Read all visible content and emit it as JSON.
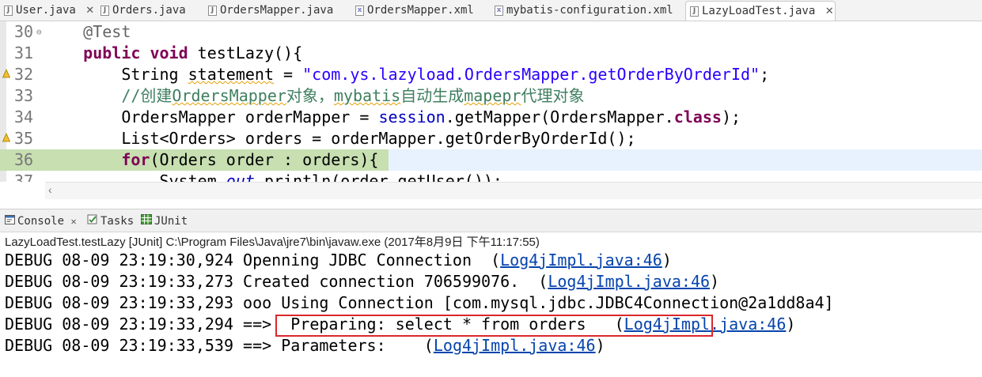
{
  "editor_tabs": [
    {
      "label": "User.java",
      "type": "java",
      "close": "✕"
    },
    {
      "label": "Orders.java",
      "type": "java"
    },
    {
      "label": "OrdersMapper.java",
      "type": "java"
    },
    {
      "label": "OrdersMapper.xml",
      "type": "xml"
    },
    {
      "label": "mybatis-configuration.xml",
      "type": "xml"
    },
    {
      "label": "LazyLoadTest.java",
      "type": "java",
      "active": true,
      "close": "✕"
    }
  ],
  "code_lines": [
    {
      "num": "30",
      "fold": "⊖",
      "parts": [
        {
          "t": "    "
        },
        {
          "t": "@Test",
          "c": "ann"
        }
      ]
    },
    {
      "num": "31",
      "parts": [
        {
          "t": "    "
        },
        {
          "t": "public",
          "c": "kw"
        },
        {
          "t": " "
        },
        {
          "t": "void",
          "c": "kw"
        },
        {
          "t": " testLazy(){"
        }
      ]
    },
    {
      "num": "32",
      "marker": true,
      "parts": [
        {
          "t": "        String "
        },
        {
          "t": "statement",
          "c": "sq"
        },
        {
          "t": " = "
        },
        {
          "t": "\"com.ys.lazyload.OrdersMapper.getOrderByOrderId\"",
          "c": "str"
        },
        {
          "t": ";"
        }
      ]
    },
    {
      "num": "33",
      "parts": [
        {
          "t": "        "
        },
        {
          "t": "//创建",
          "c": "cmt"
        },
        {
          "t": "OrdersMapper",
          "c": "cmt sq"
        },
        {
          "t": "对象，",
          "c": "cmt"
        },
        {
          "t": "mybatis",
          "c": "cmt sq"
        },
        {
          "t": "自动生成",
          "c": "cmt"
        },
        {
          "t": "mapepr",
          "c": "cmt sq"
        },
        {
          "t": "代理对象",
          "c": "cmt"
        }
      ]
    },
    {
      "num": "34",
      "parts": [
        {
          "t": "        OrdersMapper orderMapper = "
        },
        {
          "t": "session",
          "c": "fld"
        },
        {
          "t": ".getMapper(OrdersMapper."
        },
        {
          "t": "class",
          "c": "kw"
        },
        {
          "t": ");"
        }
      ]
    },
    {
      "num": "35",
      "marker": true,
      "parts": [
        {
          "t": "        List<Orders> orders = orderMapper.getOrderByOrderId();"
        }
      ]
    },
    {
      "num": "36",
      "current": true,
      "parts": [
        {
          "t": "        "
        },
        {
          "t": "for",
          "c": "kw"
        },
        {
          "t": "(Orders order : orders){"
        }
      ]
    },
    {
      "num": "37",
      "parts": [
        {
          "t": "            System."
        },
        {
          "t": "out",
          "c": "sfld"
        },
        {
          "t": ".println(order.getUser());"
        }
      ]
    }
  ],
  "view_tabs": [
    {
      "label": "Console",
      "icon": "console-icon",
      "close": "✕",
      "active": true
    },
    {
      "label": "Tasks",
      "icon": "tasks-icon"
    },
    {
      "label": "JUnit",
      "icon": "junit-icon"
    }
  ],
  "console": {
    "description": "LazyLoadTest.testLazy [JUnit] C:\\Program Files\\Java\\jre7\\bin\\javaw.exe (2017年8月9日 下午11:17:55)",
    "lines": [
      {
        "text": "DEBUG 08-09 23:19:30,924 Openning JDBC Connection  (",
        "link": "Log4jImpl.java:46",
        "after": ")"
      },
      {
        "text": "DEBUG 08-09 23:19:33,273 Created connection 706599076.  (",
        "link": "Log4jImpl.java:46",
        "after": ")"
      },
      {
        "text": "DEBUG 08-09 23:19:33,293 ooo Using Connection [com.mysql.jdbc.JDBC4Connection@2a1dd8a4]",
        "link": "",
        "after": ""
      },
      {
        "text": "DEBUG 08-09 23:19:33,294 ==>  Preparing: select * from orders   (",
        "link": "Log4jImpl.java:46",
        "after": ")"
      },
      {
        "text": "DEBUG 08-09 23:19:33,539 ==> Parameters:    (",
        "link": "Log4jImpl.java:46",
        "after": ")"
      }
    ]
  },
  "colors": {
    "accent_red": "#d9282c",
    "current_line": "#c7dfb1",
    "link": "#0645ad"
  }
}
